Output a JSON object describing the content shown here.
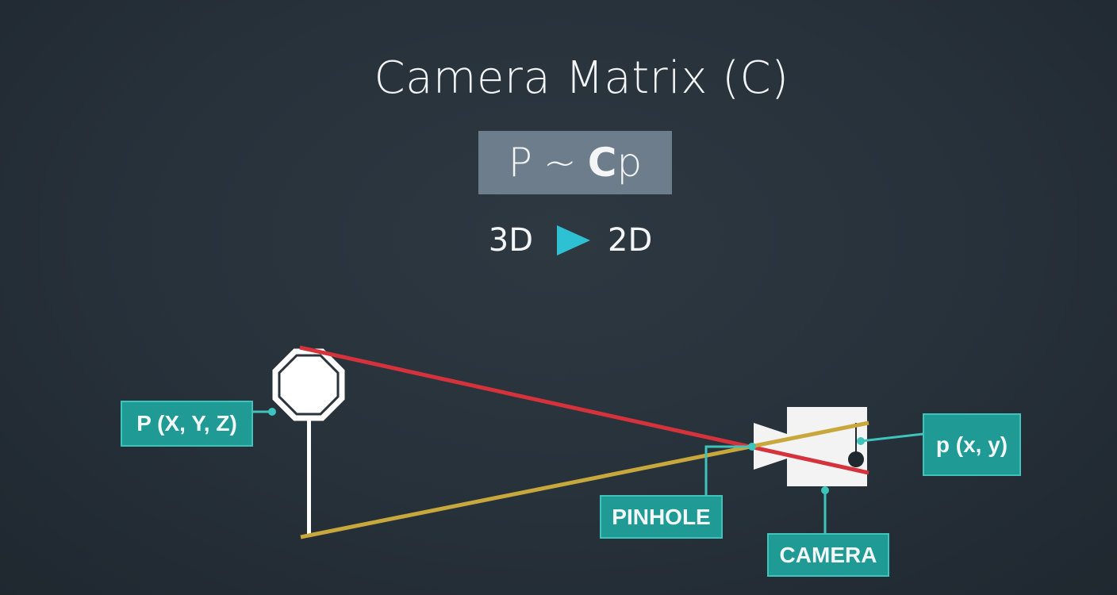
{
  "title": "Camera Matrix (C)",
  "formula": {
    "lhs": "P",
    "op": "~",
    "matrix": "C",
    "rhs": "p"
  },
  "dimension": {
    "from": "3D",
    "to": "2D",
    "arrow_icon": "play-triangle-icon"
  },
  "labels": {
    "world_point": "P (X, Y, Z)",
    "image_point": "p (x, y)",
    "pinhole": "PINHOLE",
    "camera": "CAMERA"
  },
  "colors": {
    "background": "#27313a",
    "formula_box": "#6e7d8b",
    "arrow": "#2ec1d4",
    "label_fill": "#1f9a95",
    "label_border": "#3fc3bd",
    "ray_top": "#d6323c",
    "ray_bottom": "#c8a83c",
    "sign": "#ffffff"
  }
}
